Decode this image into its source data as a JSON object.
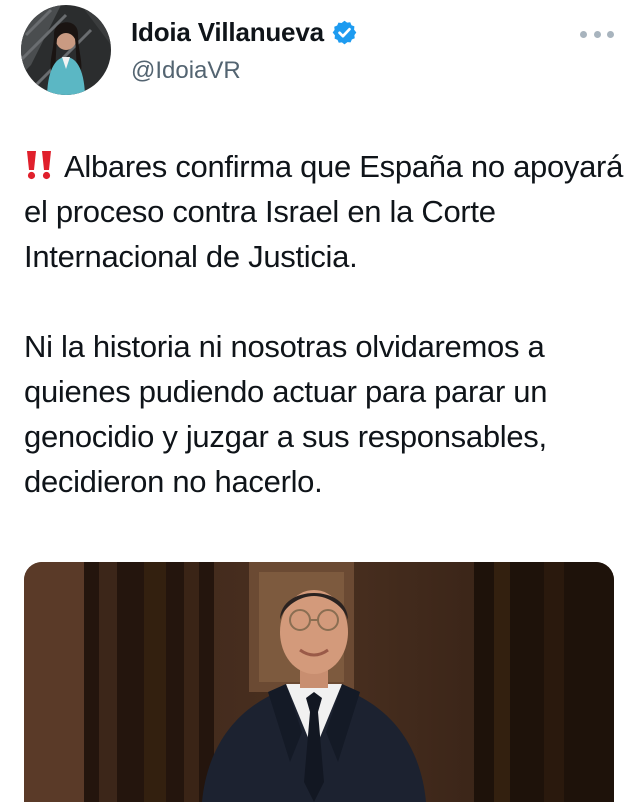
{
  "author": {
    "display_name": "Idoia Villanueva",
    "handle": "@IdoiaVR",
    "verified": true,
    "avatar_icon": "profile-photo",
    "verified_icon": "verified-badge-icon"
  },
  "more_menu_icon": "more-options-icon",
  "tweet": {
    "paragraph_1": "Albares confirma que España no apoyará el proceso contra Israel en la Corte Internacional de Justicia.",
    "paragraph_2": "Ni la historia ni nosotras olvidaremos a quienes pudiendo actuar para parar un genocidio y juzgar a sus responsables, decidieron no hacerlo.",
    "prefix_icon": "double-exclamation-icon"
  },
  "media": {
    "type": "photo",
    "subject": "portrait-photo"
  },
  "colors": {
    "text": "#0f1419",
    "secondary": "#536471",
    "verified_blue": "#1d9bf0",
    "alert_red": "#e0202c"
  }
}
